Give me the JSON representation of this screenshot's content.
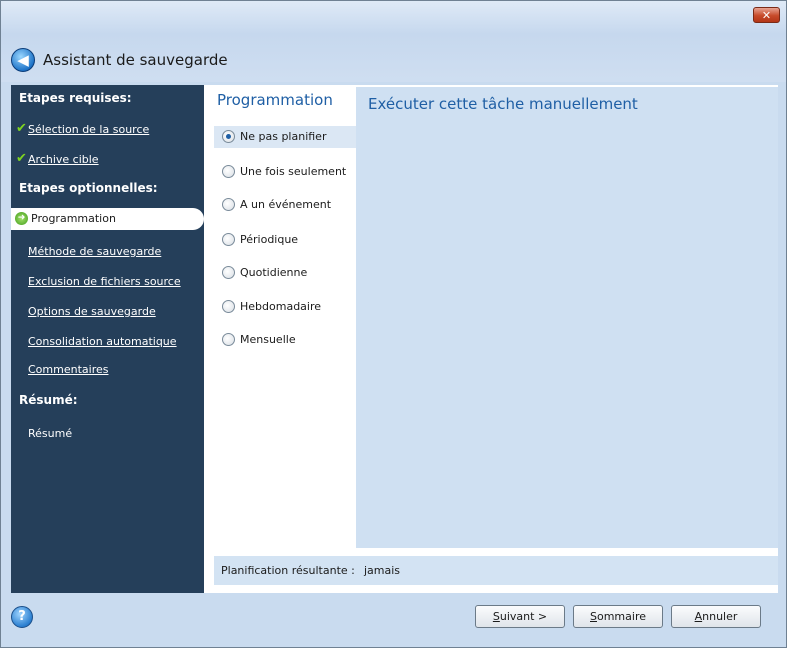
{
  "window": {
    "title": "Assistant de sauvegarde",
    "close_glyph": "✕"
  },
  "sidebar": {
    "required_heading": "Etapes requises:",
    "required_items": [
      {
        "label": "Sélection de la source",
        "done": true
      },
      {
        "label": "Archive cible",
        "done": true
      }
    ],
    "optional_heading": "Etapes optionnelles:",
    "active_item": "Programmation",
    "optional_items": [
      {
        "label": "Méthode de sauvegarde"
      },
      {
        "label": "Exclusion de fichiers source"
      },
      {
        "label": "Options de sauvegarde"
      },
      {
        "label": "Consolidation automatique"
      },
      {
        "label": "Commentaires"
      }
    ],
    "summary_heading": "Résumé:",
    "summary_item": "Résumé"
  },
  "schedule": {
    "title": "Programmation",
    "options": [
      {
        "label": "Ne pas planifier",
        "selected": true
      },
      {
        "label": "Une fois seulement",
        "selected": false
      },
      {
        "label": "A un événement",
        "selected": false
      },
      {
        "label": "Périodique",
        "selected": false
      },
      {
        "label": "Quotidienne",
        "selected": false
      },
      {
        "label": "Hebdomadaire",
        "selected": false
      },
      {
        "label": "Mensuelle",
        "selected": false
      }
    ],
    "description": "Exécuter cette tâche manuellement"
  },
  "result": {
    "label": "Planification résultante :",
    "value": "jamais"
  },
  "buttons": {
    "next": {
      "first": "S",
      "rest": "uivant >"
    },
    "summary": {
      "first": "S",
      "rest": "ommaire"
    },
    "cancel": {
      "first": "A",
      "rest": "nnuler"
    }
  },
  "icons": {
    "back": "back-arrow-icon",
    "check": "check-icon",
    "current_step": "current-step-arrow-icon",
    "help": "help-icon"
  },
  "colors": {
    "sidebar_bg": "#253f5a",
    "accent_text": "#1f5fa5",
    "check_green": "#7ed321"
  }
}
